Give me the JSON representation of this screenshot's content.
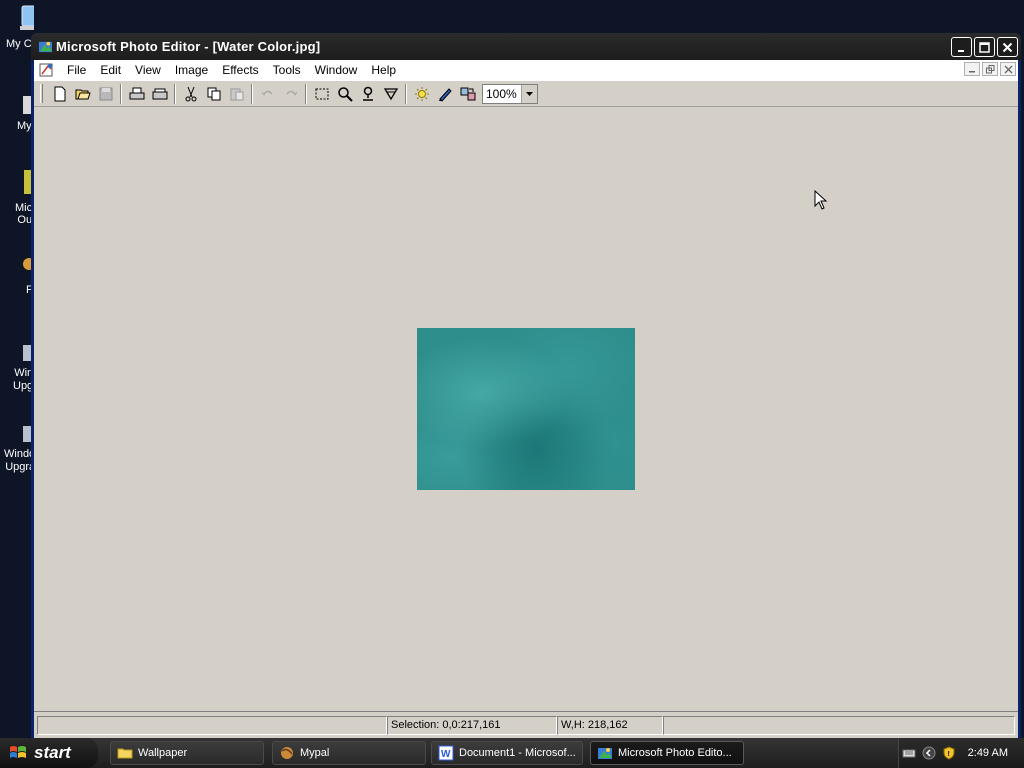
{
  "desktop": {
    "icons": [
      {
        "label": "My C",
        "color": "#7ab4ea"
      },
      {
        "label": "My",
        "color": "#c9c9c9"
      },
      {
        "label": "Mic\nOu",
        "color": "#d6c542"
      },
      {
        "label": "F",
        "color": "#d79b3a"
      },
      {
        "label": "Win\nUpg",
        "color": "#9aa4b8"
      },
      {
        "label": "Windo\nUpgra",
        "color": "#9aa4b8"
      }
    ]
  },
  "window": {
    "title": "Microsoft Photo Editor - [Water Color.jpg]",
    "menu": [
      "File",
      "Edit",
      "View",
      "Image",
      "Effects",
      "Tools",
      "Window",
      "Help"
    ],
    "toolbar": {
      "zoom_value": "100%",
      "tools": [
        "new-icon",
        "open-icon",
        "save-icon",
        "print-icon",
        "scan-icon",
        "cut-icon",
        "copy-icon",
        "paste-icon",
        "undo-icon",
        "redo-icon",
        "select-icon",
        "zoom-icon",
        "stamp-icon",
        "smudge-icon",
        "balance-icon",
        "pen-icon",
        "effects-icon"
      ]
    },
    "image": {
      "name": "Water Color.jpg",
      "color": "#2d8e8b"
    },
    "status": {
      "selection": "Selection: 0,0:217,161",
      "size": "W,H: 218,162"
    }
  },
  "taskbar": {
    "start_label": "start",
    "tasks": [
      {
        "label": "Wallpaper",
        "icon": "folder-icon"
      },
      {
        "label": "Mypal",
        "icon": "browser-icon"
      },
      {
        "label": "Document1 - Microsof...",
        "icon": "word-icon"
      },
      {
        "label": "Microsoft Photo Edito...",
        "icon": "photo-editor-icon"
      }
    ],
    "clock": "2:49 AM"
  }
}
